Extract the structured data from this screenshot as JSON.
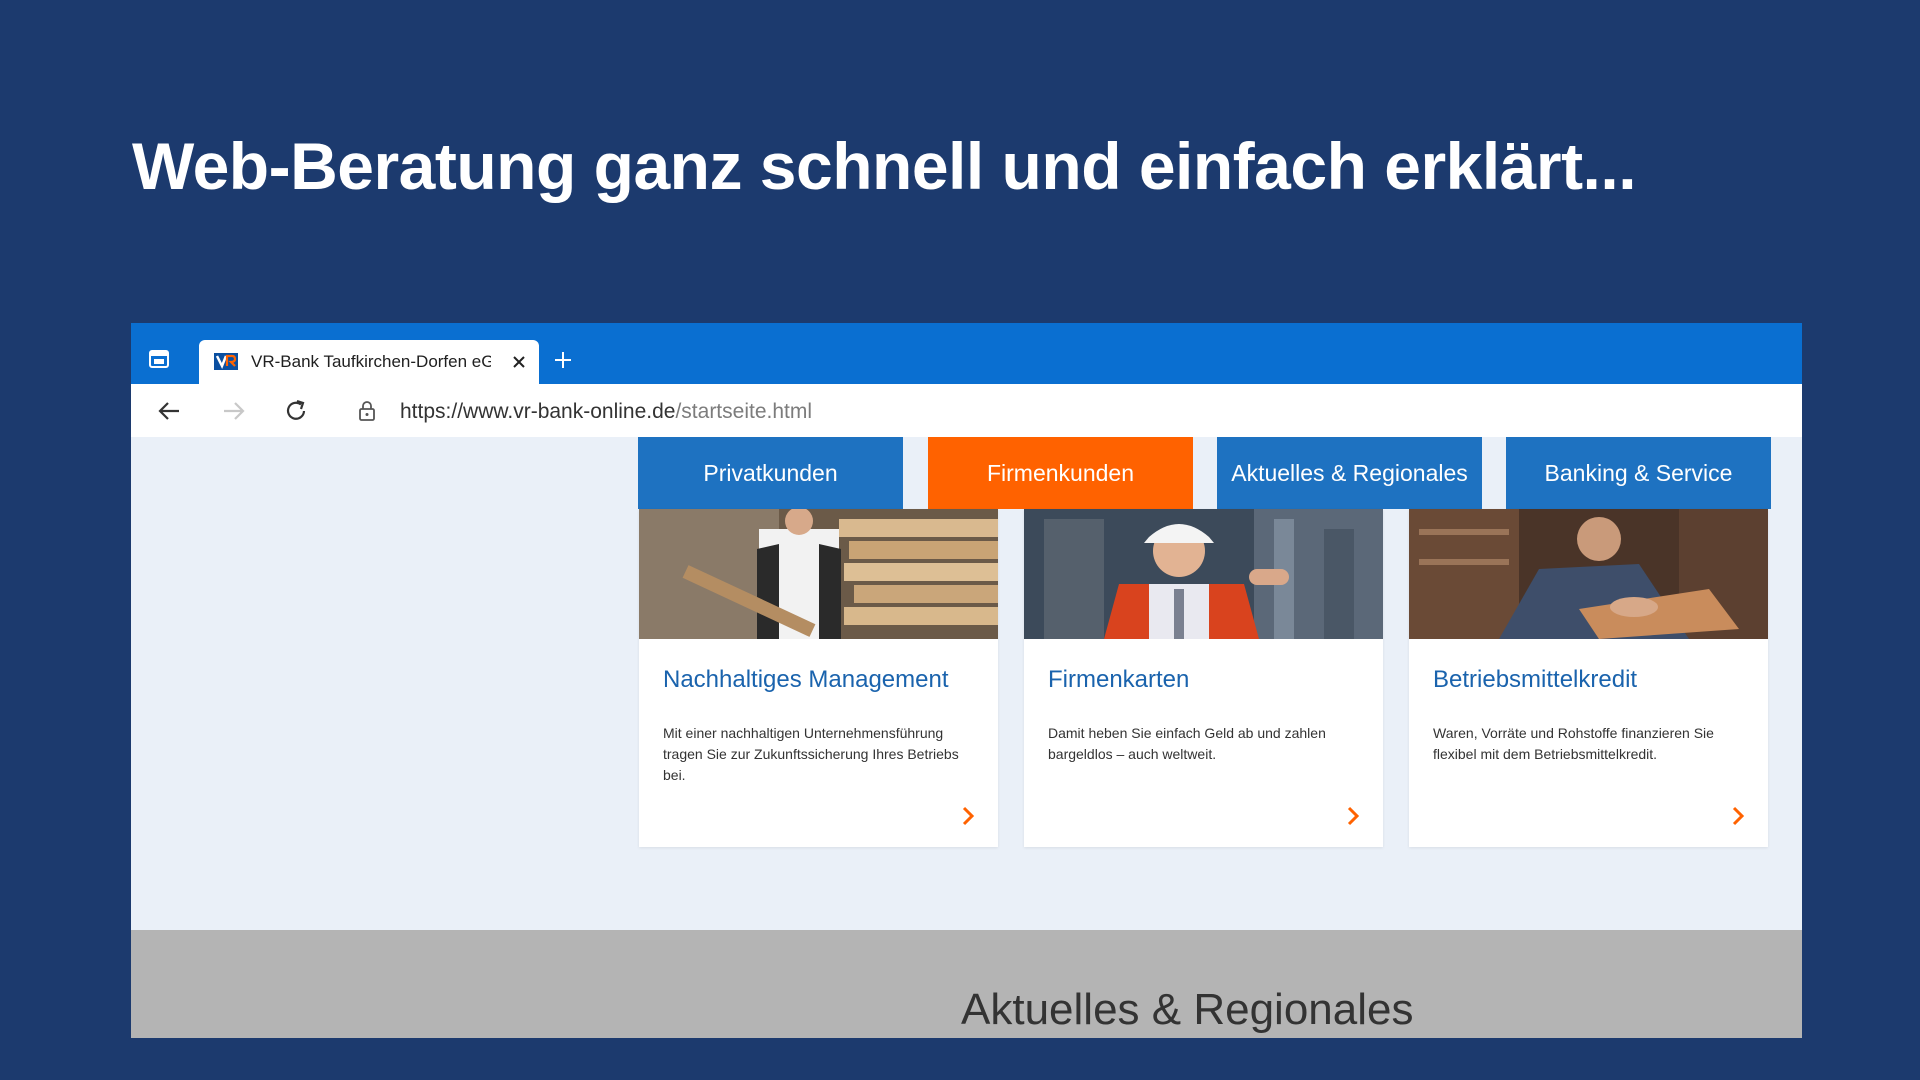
{
  "slide": {
    "title": "Web-Beratung ganz schnell und einfach erklärt..."
  },
  "browser": {
    "tab": {
      "title": "VR-Bank Taufkirchen-Dorfen eG",
      "favicon": "vr-bank-logo-icon"
    },
    "url": {
      "base": "https://www.vr-bank-online.de",
      "path": "/startseite.html"
    },
    "icons": [
      "tab-actions-icon",
      "close-icon",
      "plus-icon",
      "back-arrow-icon",
      "forward-arrow-icon",
      "reload-icon",
      "lock-icon"
    ],
    "colors": {
      "tabbar": "#0a6fd1"
    }
  },
  "site": {
    "menu": [
      {
        "label": "Privatkunden",
        "active": false
      },
      {
        "label": "Firmenkunden",
        "active": true
      },
      {
        "label": "Aktuelles & Regionales",
        "active": false
      },
      {
        "label": "Banking & Service",
        "active": false
      }
    ],
    "cards": [
      {
        "title": "Nachhaltiges Management",
        "text": "Mit einer nachhaltigen Unternehmensführung tragen Sie zur Zukunftssicherung Ihres Betriebs bei."
      },
      {
        "title": "Firmenkarten",
        "text": "Damit heben Sie einfach Geld ab und zahlen bargeldlos – auch weltweit."
      },
      {
        "title": "Betriebsmittelkredit",
        "text": "Waren, Vorräte und Rohstoffe finanzieren Sie flexibel mit dem Betriebsmittelkredit."
      }
    ],
    "section_heading": "Aktuelles & Regionales",
    "colors": {
      "primary": "#1e72c1",
      "accent": "#ff6200",
      "link": "#1a63ad"
    }
  }
}
